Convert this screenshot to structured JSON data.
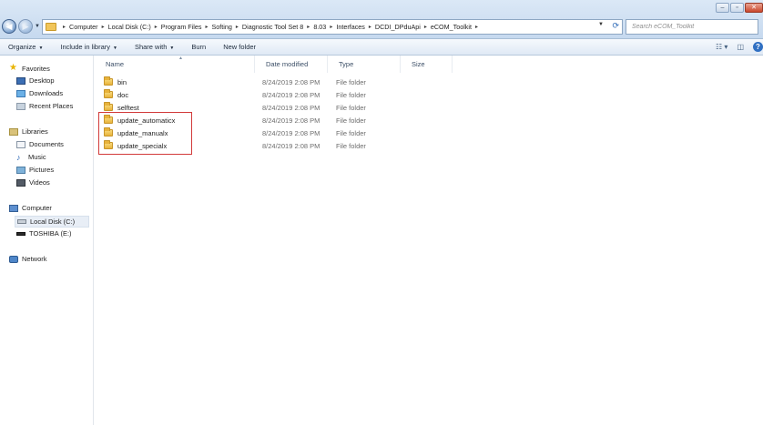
{
  "window": {
    "controls": [
      "minimize",
      "maximize",
      "close"
    ]
  },
  "nav_buttons": {
    "back_icon": "back-arrow-icon",
    "forward_icon": "forward-arrow-icon"
  },
  "address": {
    "breadcrumbs": [
      "Computer",
      "Local Disk (C:)",
      "Program Files",
      "Softing",
      "Diagnostic Tool Set 8",
      "8.03",
      "Interfaces",
      "DCDI_DPduApi",
      "eCOM_Toolkit"
    ]
  },
  "search": {
    "placeholder": "Search eCOM_Toolkit"
  },
  "toolbar": {
    "organize": "Organize",
    "include_in_library": "Include in library",
    "share_with": "Share with",
    "burn": "Burn",
    "new_folder": "New folder"
  },
  "sidebar": {
    "favorites": "Favorites",
    "desktop": "Desktop",
    "downloads": "Downloads",
    "recent_places": "Recent Places",
    "libraries": "Libraries",
    "documents": "Documents",
    "music": "Music",
    "pictures": "Pictures",
    "videos": "Videos",
    "computer": "Computer",
    "local_disk": "Local Disk (C:)",
    "toshiba": "TOSHIBA (E:)",
    "network": "Network"
  },
  "columns": {
    "name": "Name",
    "date_modified": "Date modified",
    "type": "Type",
    "size": "Size"
  },
  "files": [
    {
      "name": "bin",
      "date": "8/24/2019 2:08 PM",
      "type": "File folder"
    },
    {
      "name": "doc",
      "date": "8/24/2019 2:08 PM",
      "type": "File folder"
    },
    {
      "name": "selftest",
      "date": "8/24/2019 2:08 PM",
      "type": "File folder"
    },
    {
      "name": "update_automaticx",
      "date": "8/24/2019 2:08 PM",
      "type": "File folder"
    },
    {
      "name": "update_manualx",
      "date": "8/24/2019 2:08 PM",
      "type": "File folder"
    },
    {
      "name": "update_specialx",
      "date": "8/24/2019 2:08 PM",
      "type": "File folder"
    }
  ],
  "colors": {
    "highlight_box": "#d23a3a",
    "title_bar": "#c6d9ef",
    "folder": "#e8b33b"
  }
}
